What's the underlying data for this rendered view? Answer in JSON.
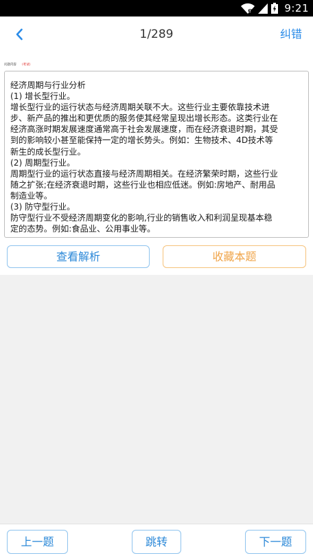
{
  "status_bar": {
    "time": "9:21"
  },
  "header": {
    "page_counter": "1/289",
    "report_label": "纠错"
  },
  "question": {
    "meta_label": "问题内容",
    "meta_tag": "(考试)",
    "answer_lines": [
      "经济周期与行业分析",
      "(1) 增长型行业。",
      "增长型行业的运行状态与经济周期关联不大。这些行业主要依靠技术进",
      "步、新产品的推出和更优质的服务使其经常呈现出增长形态。这类行业在",
      "经济高涨时期发展速度通常高于社会发展速度，而在经济衰退时期，其受",
      "到的影响较小甚至能保持一定的增长势头。例如：生物技术、4D技术等",
      "新生的成长型行业。",
      "(2) 周期型行业。",
      "周期型行业的运行状态直接与经济周期相关。在经济繁荣时期，这些行业",
      "随之扩张;在经济衰退时期，这些行业也相应低迷。例如:房地产、耐用品",
      "制造业等。",
      "(3) 防守型行业。",
      "防守型行业不受经济周期变化的影响,行业的销售收入和利润呈现基本稳",
      "定的态势。例如:食品业、公用事业等。"
    ]
  },
  "actions": {
    "view_analysis_label": "查看解析",
    "favorite_label": "收藏本题"
  },
  "bottom_nav": {
    "prev_label": "上一题",
    "jump_label": "跳转",
    "next_label": "下一题"
  },
  "colors": {
    "accent": "#2b88d8",
    "favorite": "#f0a54a",
    "tag": "#e0312d",
    "background": "#f1f1f1"
  },
  "icons": {
    "back": "chevron-left-icon",
    "wifi": "wifi-icon",
    "signal": "signal-icon",
    "battery": "battery-icon"
  }
}
